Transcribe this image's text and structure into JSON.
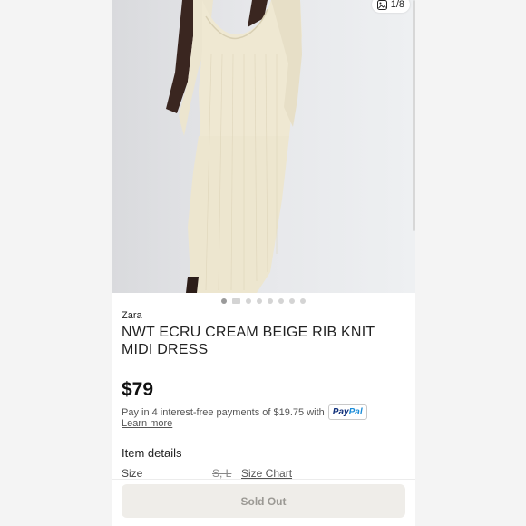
{
  "gallery": {
    "counter": "1/8",
    "icon": "image-gallery-icon",
    "total_dots": 8,
    "active_index": 0
  },
  "listing": {
    "brand": "Zara",
    "title": "NWT ECRU CREAM BEIGE RIB KNIT MIDI DRESS",
    "price": "$79"
  },
  "payment": {
    "installment_text": "Pay in 4 interest-free payments of $19.75 with",
    "paypal_pay": "Pay",
    "paypal_pal": "Pal",
    "learn_more": "Learn more"
  },
  "details": {
    "heading": "Item details",
    "size_label": "Size",
    "size_values": "S, L",
    "size_chart": "Size Chart"
  },
  "actions": {
    "sold_out_label": "Sold Out"
  }
}
